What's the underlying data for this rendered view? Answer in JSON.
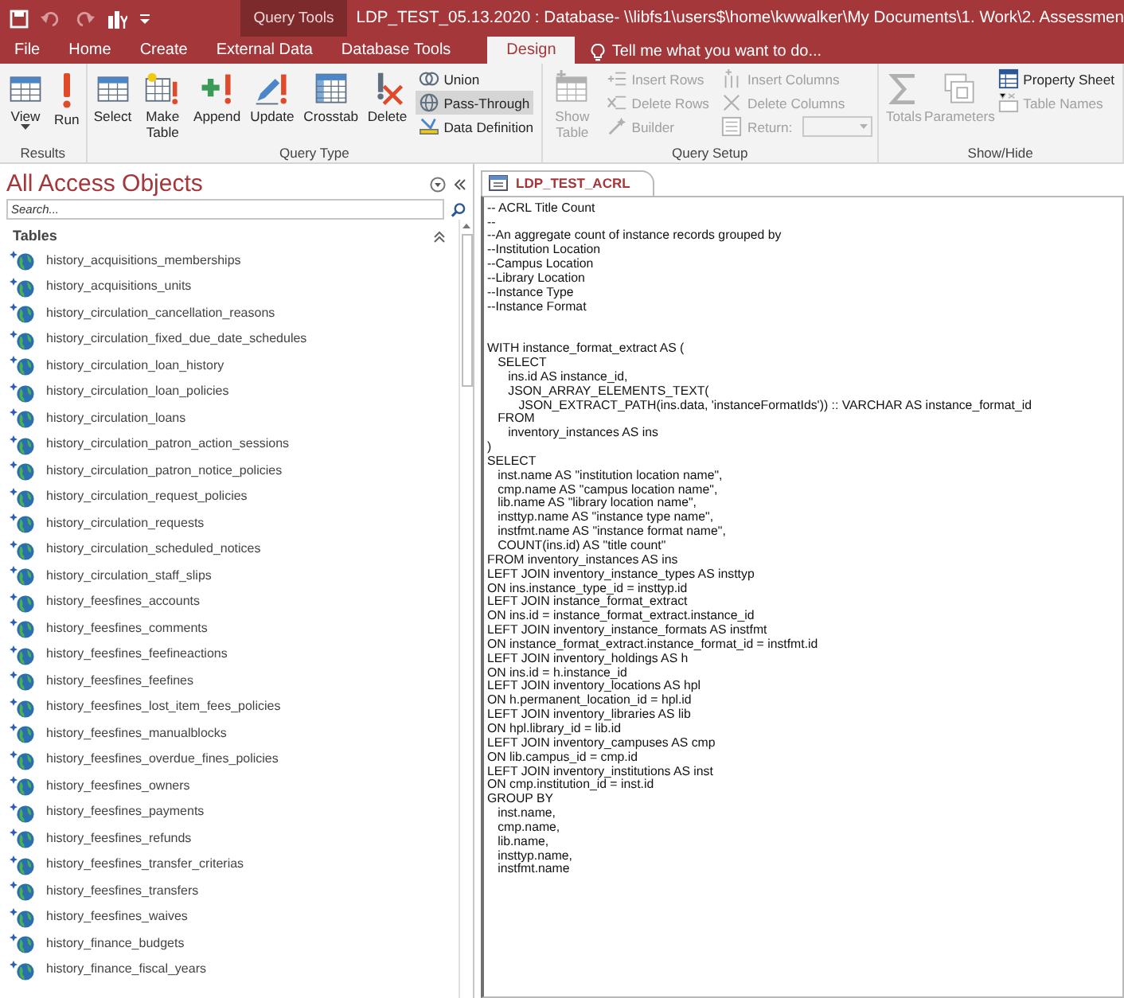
{
  "title_bar": {
    "context_label": "Query Tools",
    "title": "LDP_TEST_05.13.2020 : Database- \\\\libfs1\\users$\\home\\kwwalker\\My Documents\\1. Work\\2. Assessmen"
  },
  "ribbon_tabs": [
    {
      "label": "File",
      "selected": false
    },
    {
      "label": "Home",
      "selected": false
    },
    {
      "label": "Create",
      "selected": false
    },
    {
      "label": "External Data",
      "selected": false
    },
    {
      "label": "Database Tools",
      "selected": false
    },
    {
      "label": "Design",
      "selected": true
    }
  ],
  "tell_me": {
    "placeholder": "Tell me what you want to do..."
  },
  "ribbon_groups": [
    {
      "label": "Results",
      "items": [
        {
          "kind": "large",
          "label": "View",
          "disabled": false,
          "dropdown": true
        },
        {
          "kind": "large",
          "label": "Run",
          "disabled": false
        }
      ]
    },
    {
      "label": "Query Type",
      "items": [
        {
          "kind": "large",
          "label": "Select",
          "disabled": false
        },
        {
          "kind": "large",
          "label": "Make Table",
          "disabled": false
        },
        {
          "kind": "large",
          "label": "Append",
          "disabled": false
        },
        {
          "kind": "large",
          "label": "Update",
          "disabled": false
        },
        {
          "kind": "large",
          "label": "Crosstab",
          "disabled": false
        },
        {
          "kind": "large",
          "label": "Delete",
          "disabled": false
        },
        {
          "kind": "stack",
          "items": [
            {
              "kind": "small",
              "label": "Union",
              "disabled": false,
              "selected": false
            },
            {
              "kind": "small",
              "label": "Pass-Through",
              "disabled": false,
              "selected": true
            },
            {
              "kind": "small",
              "label": "Data Definition",
              "disabled": false,
              "selected": false
            }
          ]
        }
      ]
    },
    {
      "label": "Query Setup",
      "items": [
        {
          "kind": "large",
          "label": "Show Table",
          "disabled": true
        },
        {
          "kind": "stack",
          "items": [
            {
              "kind": "small",
              "label": "Insert Rows",
              "disabled": true
            },
            {
              "kind": "small",
              "label": "Delete Rows",
              "disabled": true
            },
            {
              "kind": "small",
              "label": "Builder",
              "disabled": true
            }
          ]
        },
        {
          "kind": "stack",
          "items": [
            {
              "kind": "small",
              "label": "Insert Columns",
              "disabled": true
            },
            {
              "kind": "small",
              "label": "Delete Columns",
              "disabled": true
            },
            {
              "kind": "combo",
              "label": "Return:",
              "disabled": true
            }
          ]
        }
      ]
    },
    {
      "label": "Show/Hide",
      "items": [
        {
          "kind": "large",
          "label": "Totals",
          "disabled": true
        },
        {
          "kind": "large",
          "label": "Parameters",
          "disabled": true
        },
        {
          "kind": "stack",
          "items": [
            {
              "kind": "small",
              "label": "Property Sheet",
              "disabled": false
            },
            {
              "kind": "small",
              "label": "Table Names",
              "disabled": true
            }
          ]
        }
      ]
    }
  ],
  "nav_pane": {
    "title": "All Access Objects",
    "search": {
      "placeholder": "Search..."
    },
    "group": {
      "label": "Tables",
      "expanded": true
    },
    "items": [
      "history_acquisitions_memberships",
      "history_acquisitions_units",
      "history_circulation_cancellation_reasons",
      "history_circulation_fixed_due_date_schedules",
      "history_circulation_loan_history",
      "history_circulation_loan_policies",
      "history_circulation_loans",
      "history_circulation_patron_action_sessions",
      "history_circulation_patron_notice_policies",
      "history_circulation_request_policies",
      "history_circulation_requests",
      "history_circulation_scheduled_notices",
      "history_circulation_staff_slips",
      "history_feesfines_accounts",
      "history_feesfines_comments",
      "history_feesfines_feefineactions",
      "history_feesfines_feefines",
      "history_feesfines_lost_item_fees_policies",
      "history_feesfines_manualblocks",
      "history_feesfines_overdue_fines_policies",
      "history_feesfines_owners",
      "history_feesfines_payments",
      "history_feesfines_refunds",
      "history_feesfines_transfer_criterias",
      "history_feesfines_transfers",
      "history_feesfines_waives",
      "history_finance_budgets",
      "history_finance_fiscal_years"
    ]
  },
  "document_tab": {
    "label": "LDP_TEST_ACRL",
    "selected": true
  },
  "sql_text": "-- ACRL Title Count\n--\n--An aggregate count of instance records grouped by\n--Institution Location\n--Campus Location\n--Library Location\n--Instance Type\n--Instance Format\n\n\nWITH instance_format_extract AS (\n   SELECT\n      ins.id AS instance_id,\n      JSON_ARRAY_ELEMENTS_TEXT(\n         JSON_EXTRACT_PATH(ins.data, 'instanceFormatIds')) :: VARCHAR AS instance_format_id\n   FROM\n      inventory_instances AS ins\n)\nSELECT\n   inst.name AS \"institution location name\",\n   cmp.name AS \"campus location name\",\n   lib.name AS \"library location name\",\n   insttyp.name AS \"instance type name\",\n   instfmt.name AS \"instance format name\",\n   COUNT(ins.id) AS \"title count\"\nFROM inventory_instances AS ins\nLEFT JOIN inventory_instance_types AS insttyp\nON ins.instance_type_id = insttyp.id\nLEFT JOIN instance_format_extract\nON ins.id = instance_format_extract.instance_id\nLEFT JOIN inventory_instance_formats AS instfmt\nON instance_format_extract.instance_format_id = instfmt.id\nLEFT JOIN inventory_holdings AS h\nON ins.id = h.instance_id\nLEFT JOIN inventory_locations AS hpl\nON h.permanent_location_id = hpl.id\nLEFT JOIN inventory_libraries AS lib\nON hpl.library_id = lib.id\nLEFT JOIN inventory_campuses AS cmp\nON lib.campus_id = cmp.id\nLEFT JOIN inventory_institutions AS inst\nON cmp.institution_id = inst.id\nGROUP BY\n   inst.name,\n   cmp.name,\n   lib.name,\n   insttyp.name,\n   instfmt.name"
}
